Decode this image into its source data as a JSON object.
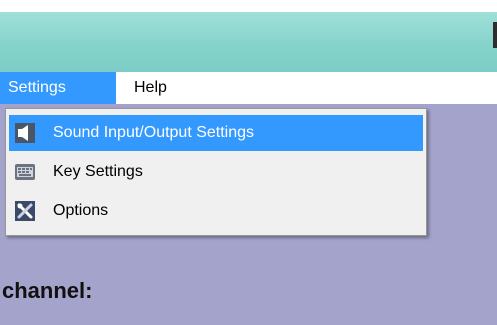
{
  "menubar": {
    "settings_label": "Settings",
    "help_label": "Help"
  },
  "settings_menu": {
    "items": [
      {
        "label": "Sound Input/Output Settings",
        "icon": "speaker-icon",
        "highlighted": true
      },
      {
        "label": "Key Settings",
        "icon": "keyboard-icon",
        "highlighted": false
      },
      {
        "label": "Options",
        "icon": "tools-icon",
        "highlighted": false
      }
    ]
  },
  "content": {
    "channel_label": "channel:"
  },
  "colors": {
    "highlight": "#3399ff",
    "content_bg": "#a3a3cc",
    "titlebar": "#86d3cb"
  }
}
